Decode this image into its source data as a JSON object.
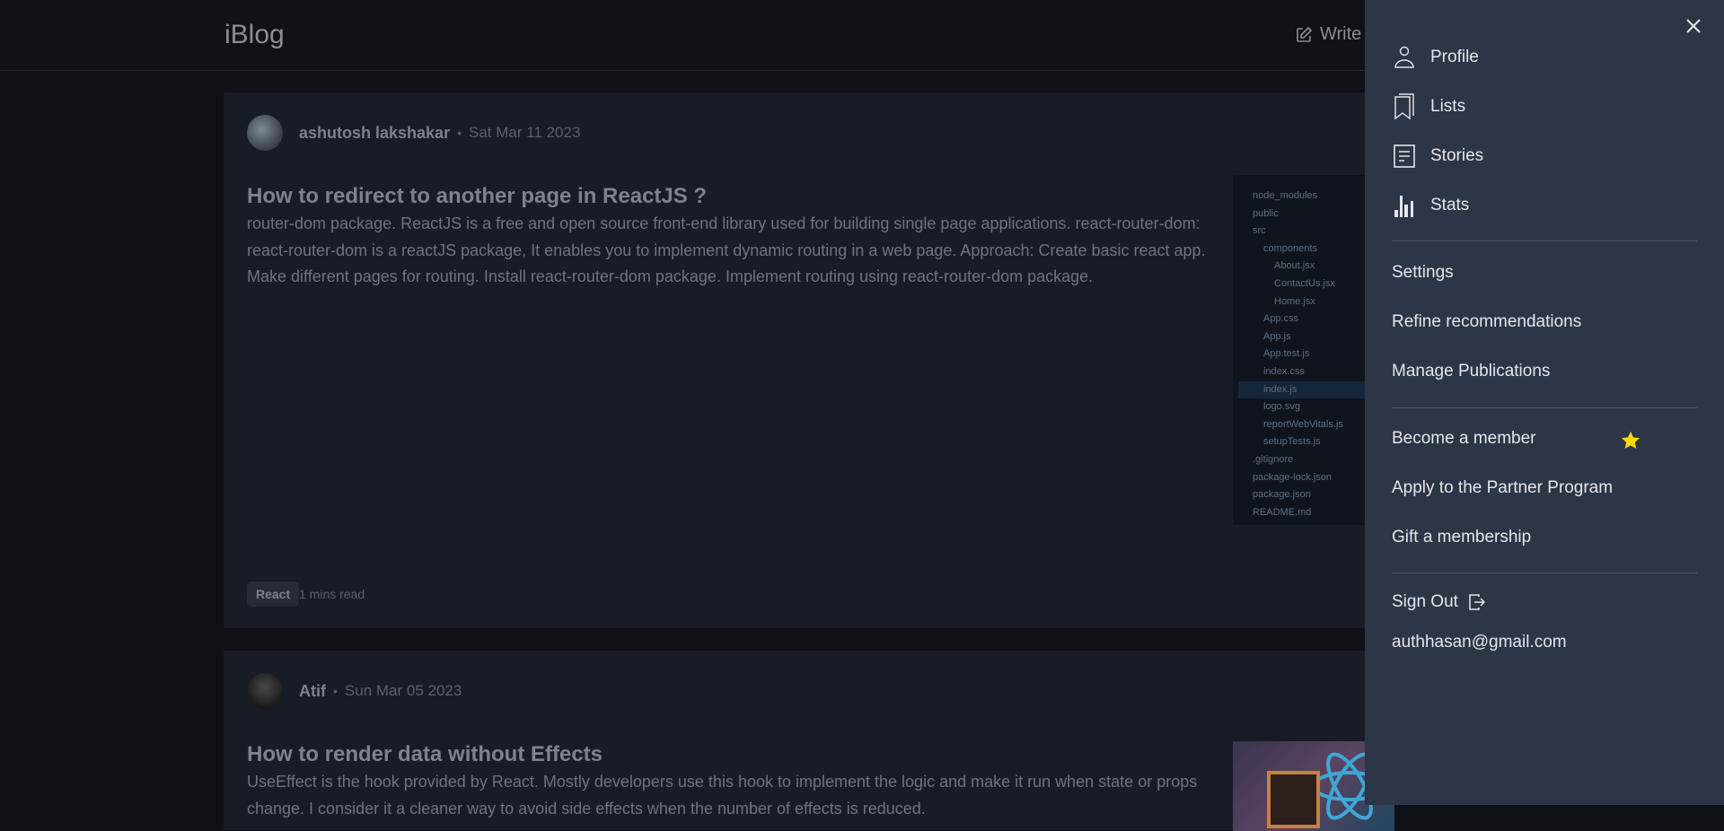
{
  "header": {
    "logo": "iBlog",
    "write_label": "Write"
  },
  "posts": [
    {
      "author": "ashutosh lakshakar",
      "date": "Sat Mar 11 2023",
      "title": "How to redirect to another page in ReactJS ?",
      "excerpt": "router-dom package. ReactJS is a free and open source front-end library used for building single page applications. react-router-dom: react-router-dom is a reactJS package, It enables you to implement dynamic routing in a web page. Approach: Create basic react app. Make different pages for routing. Install react-router-dom package. Implement routing using react-router-dom package.",
      "tag": "React",
      "read_time": "1 mins read",
      "thumbnail_files": [
        "node_modules",
        "public",
        "src",
        "components",
        "About.jsx",
        "ContactUs.jsx",
        "Home.jsx",
        "App.css",
        "App.js",
        "App.test.js",
        "index.css",
        "index.js",
        "logo.svg",
        "reportWebVitals.js",
        "setupTests.js",
        ".gitignore",
        "package-lock.json",
        "package.json",
        "README.md"
      ]
    },
    {
      "author": "Atif",
      "date": "Sun Mar 05 2023",
      "title": "How to render data without Effects",
      "excerpt": "UseEffect is the hook provided by React. Mostly developers use this hook to implement the logic and make it run when state or props change. I consider it a cleaner way to avoid side effects when the number of effects is reduced."
    }
  ],
  "menu": {
    "primary": [
      {
        "label": "Profile",
        "icon": "person-icon"
      },
      {
        "label": "Lists",
        "icon": "bookmarks-icon"
      },
      {
        "label": "Stories",
        "icon": "document-icon"
      },
      {
        "label": "Stats",
        "icon": "bar-chart-icon"
      }
    ],
    "secondary": [
      "Settings",
      "Refine recommendations",
      "Manage Publications"
    ],
    "membership": [
      "Become a member",
      "Apply to the Partner Program",
      "Gift a membership"
    ],
    "sign_out": "Sign Out",
    "email": "authhasan@gmail.com",
    "star_color": "#ffd60a"
  }
}
